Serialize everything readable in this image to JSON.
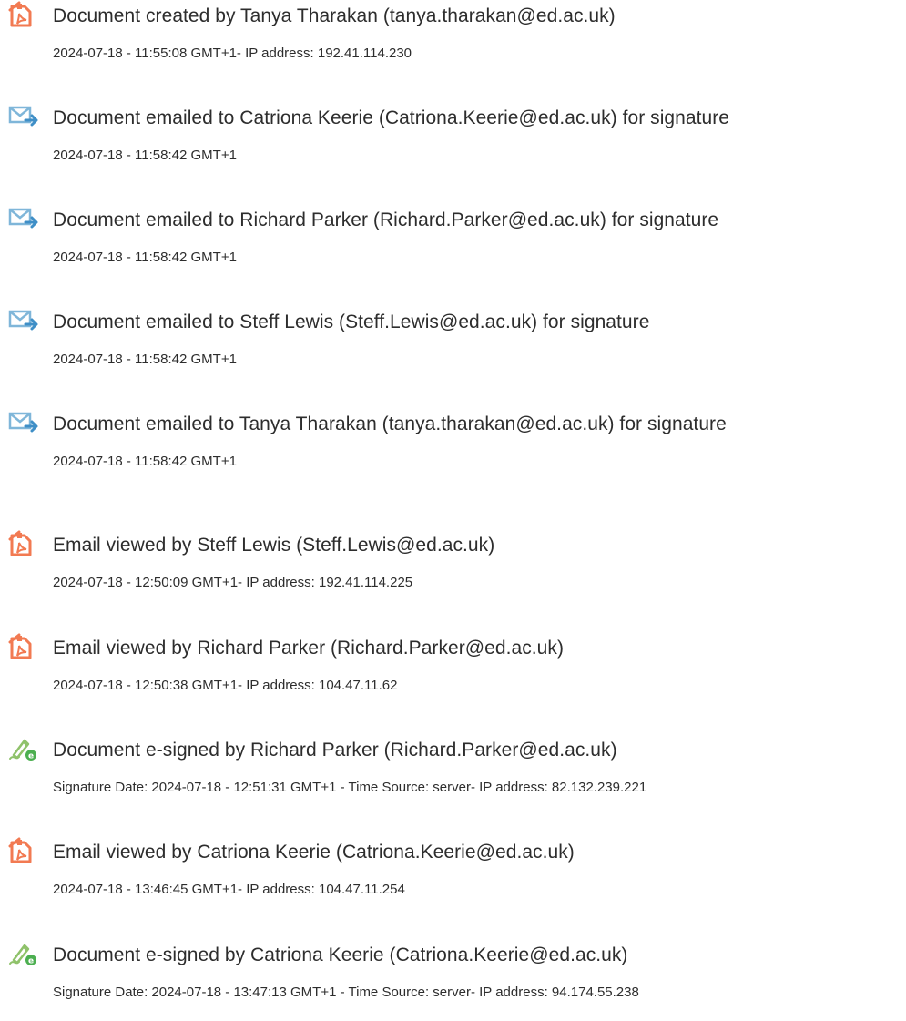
{
  "colors": {
    "pdf_icon": "#f27a52",
    "email_icon": "#7fb6d9",
    "email_arrow": "#3f8fc7",
    "sign_icon": "#8fc26a",
    "sign_badge": "#4caf50",
    "text": "#2d2d2d"
  },
  "events": [
    {
      "icon": "pdf-document-icon",
      "title": "Document created by Tanya Tharakan (tanya.tharakan@ed.ac.uk)",
      "meta": "2024-07-18 - 11:55:08 GMT+1- IP address: 192.41.114.230"
    },
    {
      "icon": "email-sent-icon",
      "title": "Document emailed to Catriona Keerie (Catriona.Keerie@ed.ac.uk) for signature",
      "meta": "2024-07-18 - 11:58:42 GMT+1"
    },
    {
      "icon": "email-sent-icon",
      "title": "Document emailed to Richard Parker (Richard.Parker@ed.ac.uk) for signature",
      "meta": "2024-07-18 - 11:58:42 GMT+1"
    },
    {
      "icon": "email-sent-icon",
      "title": "Document emailed to Steff Lewis (Steff.Lewis@ed.ac.uk) for signature",
      "meta": "2024-07-18 - 11:58:42 GMT+1"
    },
    {
      "icon": "email-sent-icon",
      "title": "Document emailed to Tanya Tharakan (tanya.tharakan@ed.ac.uk) for signature",
      "meta": "2024-07-18 - 11:58:42 GMT+1"
    },
    {
      "icon": "pdf-document-icon",
      "title": "Email viewed by Steff Lewis (Steff.Lewis@ed.ac.uk)",
      "meta": "2024-07-18 - 12:50:09 GMT+1- IP address: 192.41.114.225"
    },
    {
      "icon": "pdf-document-icon",
      "title": "Email viewed by Richard Parker (Richard.Parker@ed.ac.uk)",
      "meta": "2024-07-18 - 12:50:38 GMT+1- IP address: 104.47.11.62"
    },
    {
      "icon": "esign-pen-icon",
      "title": "Document e-signed by Richard Parker (Richard.Parker@ed.ac.uk)",
      "meta": "Signature Date: 2024-07-18 - 12:51:31 GMT+1 - Time Source: server- IP address: 82.132.239.221"
    },
    {
      "icon": "pdf-document-icon",
      "title": "Email viewed by Catriona Keerie (Catriona.Keerie@ed.ac.uk)",
      "meta": "2024-07-18 - 13:46:45 GMT+1- IP address: 104.47.11.254"
    },
    {
      "icon": "esign-pen-icon",
      "title": "Document e-signed by Catriona Keerie (Catriona.Keerie@ed.ac.uk)",
      "meta": "Signature Date: 2024-07-18 - 13:47:13 GMT+1 - Time Source: server- IP address: 94.174.55.238"
    }
  ]
}
